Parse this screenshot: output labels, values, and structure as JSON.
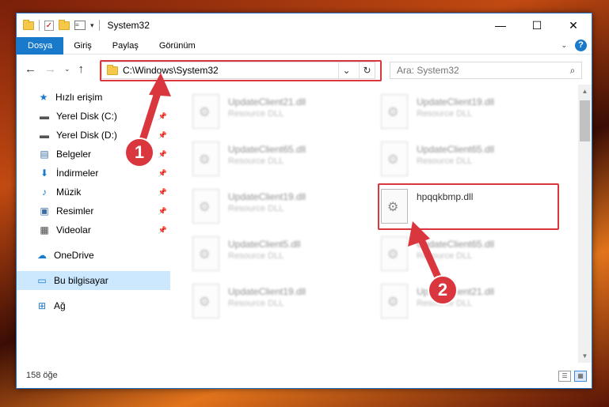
{
  "window": {
    "title": "System32",
    "controls": {
      "minimize": "—",
      "maximize": "☐",
      "close": "✕"
    }
  },
  "ribbon": {
    "tabs": [
      "Dosya",
      "Giriş",
      "Paylaş",
      "Görünüm"
    ],
    "active_tab": 0
  },
  "navbar": {
    "back": "←",
    "forward": "→",
    "recent": "⌄",
    "up": "↑",
    "address": "C:\\Windows\\System32",
    "search_placeholder": "Ara: System32"
  },
  "sidebar": {
    "items": [
      {
        "label": "Hızlı erişim",
        "icon": "star-icon",
        "glyph": "★",
        "color": "#1979ca",
        "pinned": false
      },
      {
        "label": "Yerel Disk (C:)",
        "icon": "drive-icon",
        "glyph": "▬",
        "color": "#555",
        "pinned": true
      },
      {
        "label": "Yerel Disk (D:)",
        "icon": "drive-icon",
        "glyph": "▬",
        "color": "#555",
        "pinned": true
      },
      {
        "label": "Belgeler",
        "icon": "documents-icon",
        "glyph": "▤",
        "color": "#3a6ea5",
        "pinned": true
      },
      {
        "label": "İndirmeler",
        "icon": "download-icon",
        "glyph": "⬇",
        "color": "#1979ca",
        "pinned": true
      },
      {
        "label": "Müzik",
        "icon": "music-icon",
        "glyph": "♪",
        "color": "#1979ca",
        "pinned": true
      },
      {
        "label": "Resimler",
        "icon": "pictures-icon",
        "glyph": "▣",
        "color": "#3a6ea5",
        "pinned": true
      },
      {
        "label": "Videolar",
        "icon": "video-icon",
        "glyph": "▦",
        "color": "#444",
        "pinned": true
      },
      {
        "label": "OneDrive",
        "icon": "cloud-icon",
        "glyph": "☁",
        "color": "#1979ca",
        "pinned": false
      },
      {
        "label": "Bu bilgisayar",
        "icon": "computer-icon",
        "glyph": "▭",
        "color": "#1979ca",
        "pinned": false,
        "selected": true
      },
      {
        "label": "Ağ",
        "icon": "network-icon",
        "glyph": "⊞",
        "color": "#1979ca",
        "pinned": false
      }
    ]
  },
  "files": [
    {
      "name": "UpdateClient21.dll",
      "type": "Resource DLL"
    },
    {
      "name": "UpdateClient19.dll",
      "type": "Resource DLL"
    },
    {
      "name": "UpdateClient65.dll",
      "type": "Resource DLL"
    },
    {
      "name": "UpdateClient65.dll",
      "type": "Resource DLL"
    },
    {
      "name": "UpdateClient19.dll",
      "type": "Resource DLL"
    },
    {
      "name": "hpqqkbmp.dll",
      "type": ""
    },
    {
      "name": "UpdateClient5.dll",
      "type": "Resource DLL"
    },
    {
      "name": "UpdateClient65.dll",
      "type": "Resource DLL"
    },
    {
      "name": "UpdateClient19.dll",
      "type": "Resource DLL"
    },
    {
      "name": "UpdateClient21.dll",
      "type": "Resource DLL"
    }
  ],
  "status": {
    "item_count": "158 öğe"
  },
  "annotations": {
    "step1": "1",
    "step2": "2",
    "color": "#d9363e"
  }
}
